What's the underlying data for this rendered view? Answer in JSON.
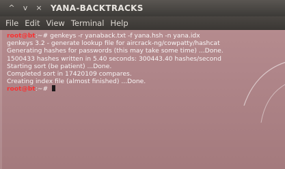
{
  "window": {
    "title": "YANA-BACKTRACKS",
    "controls": [
      "^",
      "v",
      "×"
    ]
  },
  "menubar": {
    "items": [
      "File",
      "Edit",
      "View",
      "Terminal",
      "Help"
    ]
  },
  "terminal": {
    "lines": [
      {
        "prompt": "root@bt",
        "text": ":~# genkeys -r yanaback.txt -f yana.hsh -n yana.idx"
      },
      {
        "prompt": "",
        "text": "genkeys 3.2 - generate lookup file for aircrack-ng/cowpatty/hashcat"
      },
      {
        "prompt": "",
        "text": "Generating hashes for passwords (this may take some time) ...Done."
      },
      {
        "prompt": "",
        "text": "1500433 hashes written in 5.40 seconds: 300443.40 hashes/second"
      },
      {
        "prompt": "",
        "text": "Starting sort (be patient) ...Done."
      },
      {
        "prompt": "",
        "text": "Completed sort in 17420109 compares."
      },
      {
        "prompt": "",
        "text": "Creating index file (almost finished) ...Done."
      },
      {
        "prompt": "root@bt",
        "text": ":~# "
      }
    ]
  },
  "colors": {
    "prompt": "#ff2b2b",
    "text": "#ffffff",
    "background": "#b0868a"
  }
}
